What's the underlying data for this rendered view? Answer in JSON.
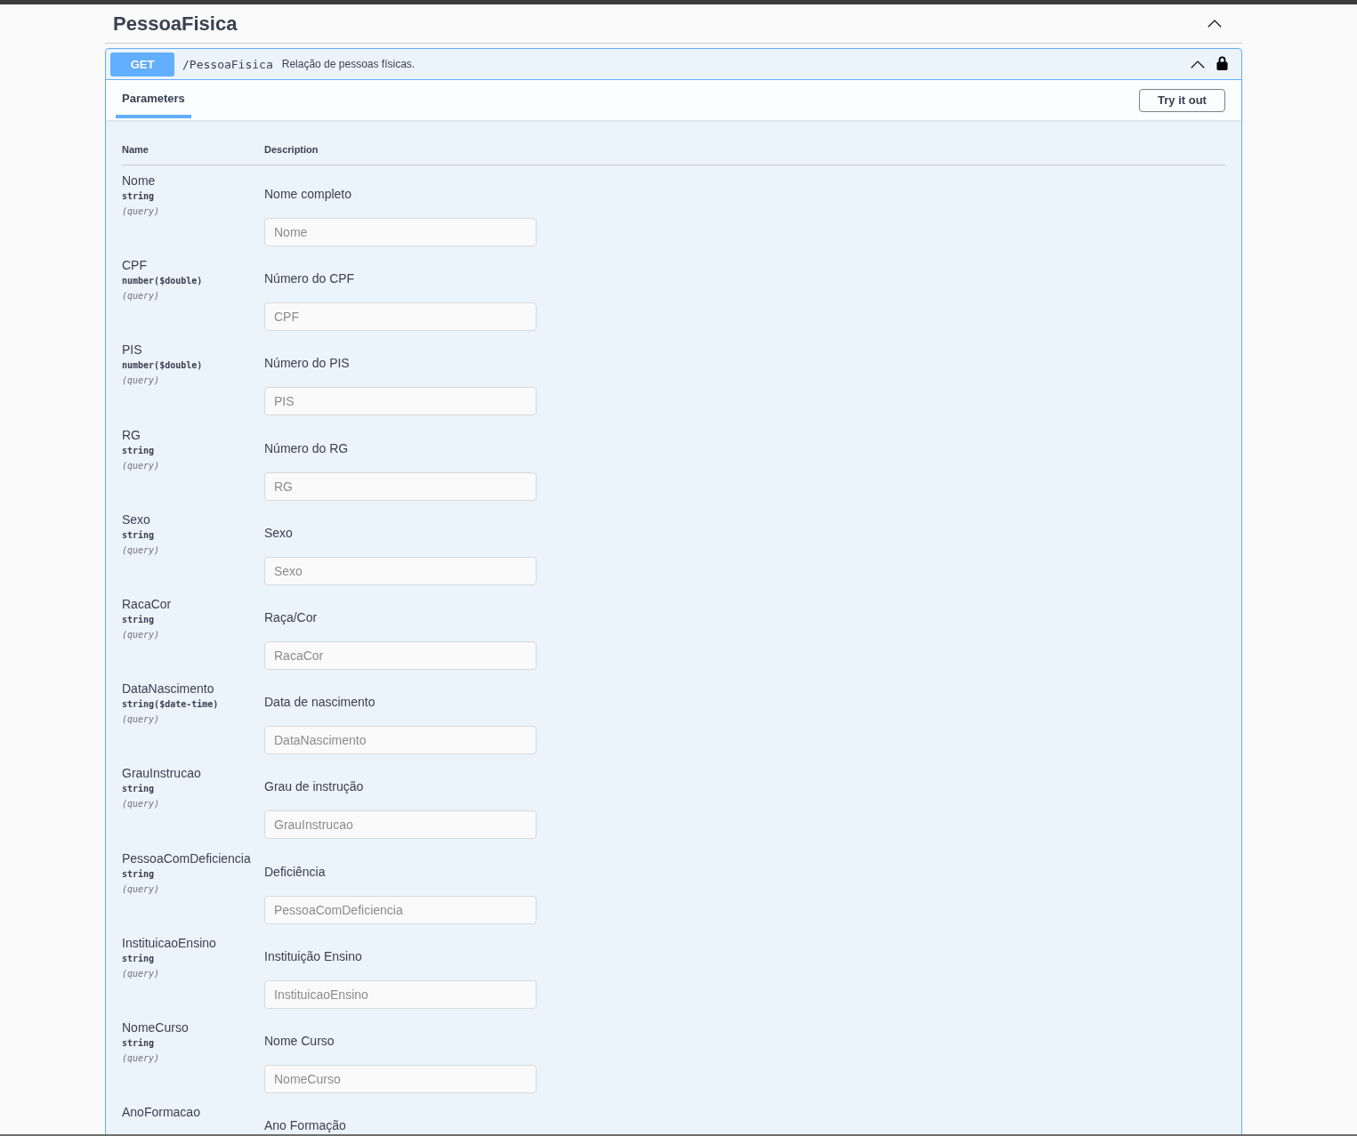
{
  "section": {
    "title": "PessoaFisica",
    "expanded": true
  },
  "operation": {
    "kind": "get",
    "method": "GET",
    "path": "/PessoaFisica",
    "summary": "Relação de pessoas físicas.",
    "expanded": true,
    "locked": true
  },
  "tabs": [
    {
      "label": "Parameters",
      "selected": true
    }
  ],
  "try_it_out": {
    "label": "Try it out"
  },
  "parameters_table": {
    "columns": [
      "Name",
      "Description"
    ],
    "rows": [
      {
        "name": "Nome",
        "type": "string",
        "location": "(query)",
        "description": "Nome completo",
        "placeholder": "Nome"
      },
      {
        "name": "CPF",
        "type": "number($double)",
        "location": "(query)",
        "description": "Número do CPF",
        "placeholder": "CPF"
      },
      {
        "name": "PIS",
        "type": "number($double)",
        "location": "(query)",
        "description": "Número do PIS",
        "placeholder": "PIS"
      },
      {
        "name": "RG",
        "type": "string",
        "location": "(query)",
        "description": "Número do RG",
        "placeholder": "RG"
      },
      {
        "name": "Sexo",
        "type": "string",
        "location": "(query)",
        "description": "Sexo",
        "placeholder": "Sexo"
      },
      {
        "name": "RacaCor",
        "type": "string",
        "location": "(query)",
        "description": "Raça/Cor",
        "placeholder": "RacaCor"
      },
      {
        "name": "DataNascimento",
        "type": "string($date-time)",
        "location": "(query)",
        "description": "Data de nascimento",
        "placeholder": "DataNascimento"
      },
      {
        "name": "GrauInstrucao",
        "type": "string",
        "location": "(query)",
        "description": "Grau de instrução",
        "placeholder": "GrauInstrucao"
      },
      {
        "name": "PessoaComDeficiencia",
        "type": "string",
        "location": "(query)",
        "description": "Deficiência",
        "placeholder": "PessoaComDeficiencia"
      },
      {
        "name": "InstituicaoEnsino",
        "type": "string",
        "location": "(query)",
        "description": "Instituição Ensino",
        "placeholder": "InstituicaoEnsino"
      },
      {
        "name": "NomeCurso",
        "type": "string",
        "location": "(query)",
        "description": "Nome Curso",
        "placeholder": "NomeCurso"
      },
      {
        "name": "AnoFormacao",
        "description": "Ano Formação"
      }
    ]
  }
}
